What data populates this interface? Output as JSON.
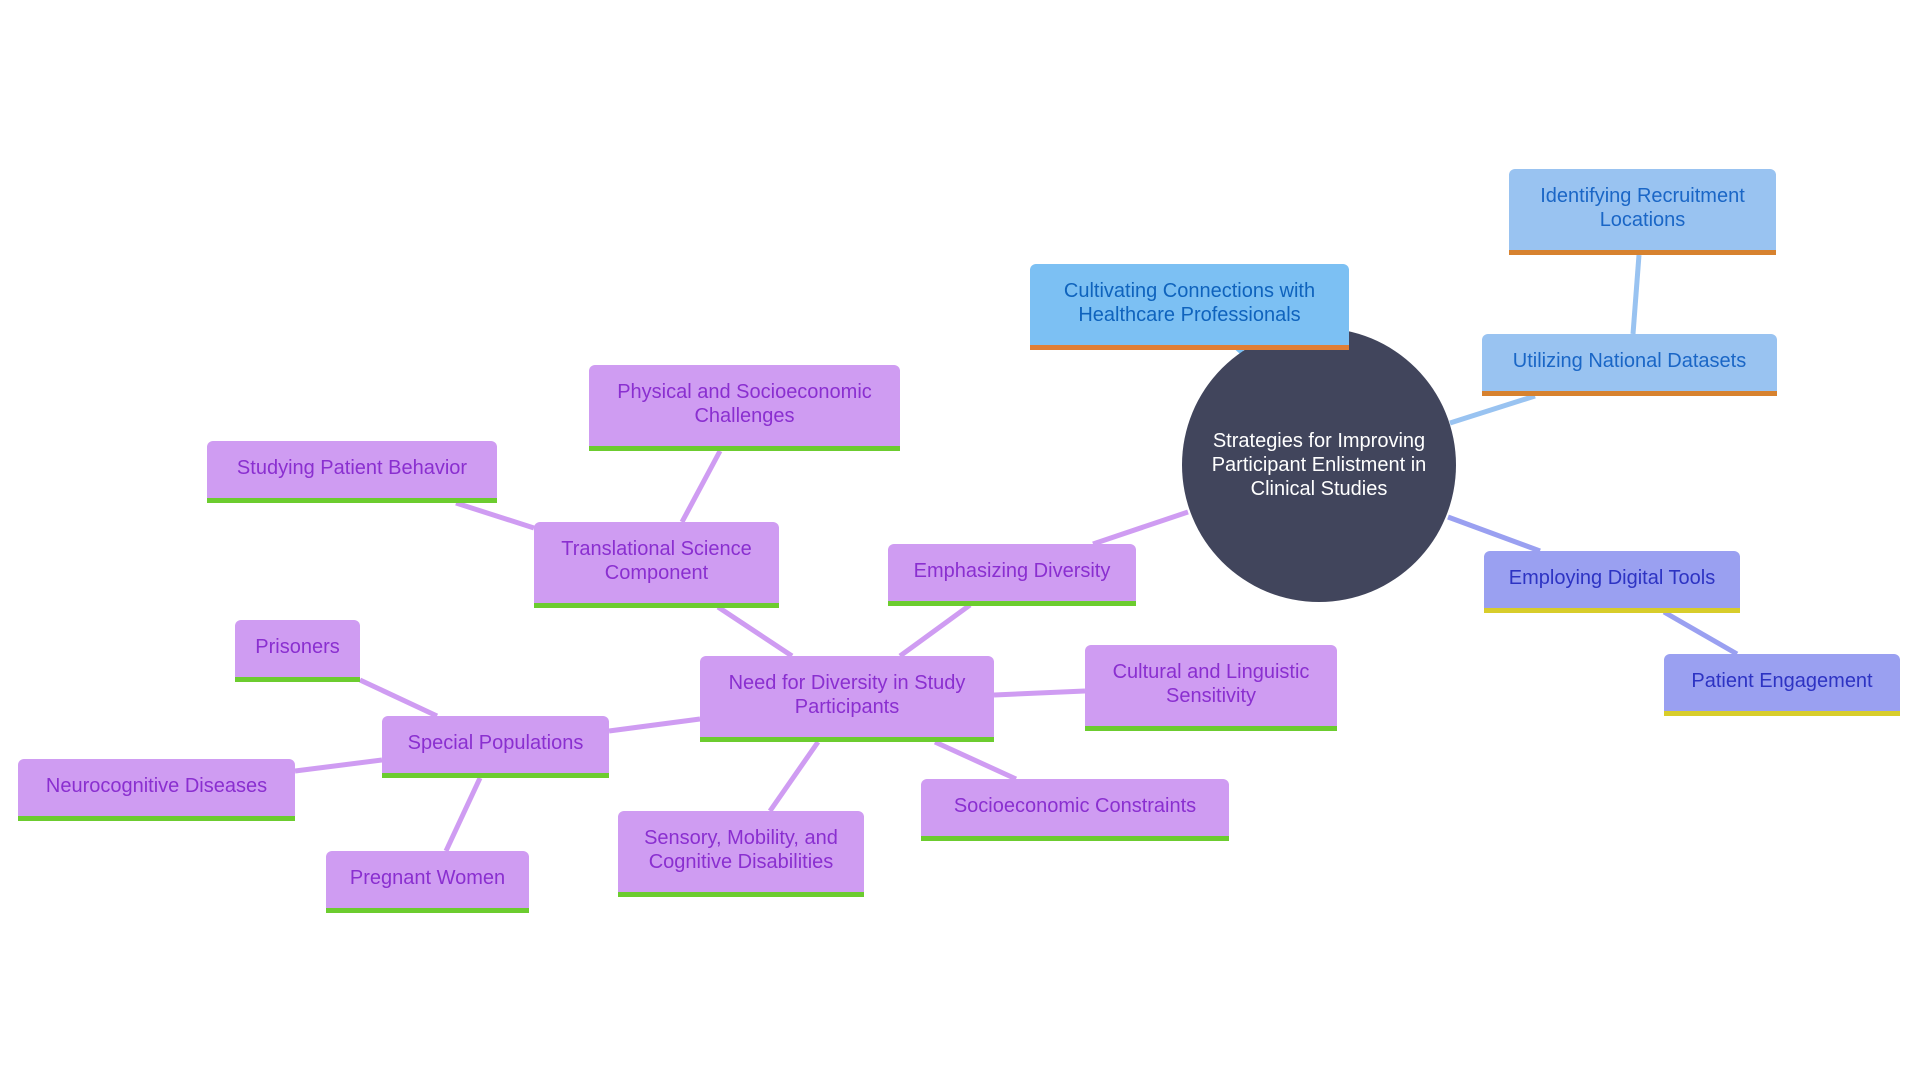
{
  "root": {
    "id": "root",
    "label": "Strategies for Improving Participant Enlistment in Clinical Studies",
    "color": "#41455c"
  },
  "colors": {
    "purple_fill": "#cf9cf2",
    "purple_text": "#8a2fd0",
    "purple_edge": "#cf9cf2",
    "green_accent": "#6ccc2f",
    "skyblue_fill": "#7cc0f3",
    "lightblue_fill": "#99c3f1",
    "blue_edge": "#99c3f1",
    "orange_accent": "#e07e35",
    "periwinkle_fill": "#9aa0f1",
    "periwinkle_edge": "#9aa0f1",
    "yellow_accent": "#d8cd2b"
  },
  "nodes": [
    {
      "id": "cultivating",
      "label": "Cultivating Connections with Healthcare Professionals",
      "parent": "root",
      "style": "skyblue"
    },
    {
      "id": "utilizing",
      "label": "Utilizing National Datasets",
      "parent": "root",
      "style": "lightblue"
    },
    {
      "id": "identifying",
      "label": "Identifying Recruitment Locations",
      "parent": "utilizing",
      "style": "lightblue"
    },
    {
      "id": "employing",
      "label": "Employing Digital Tools",
      "parent": "root",
      "style": "periwinkle"
    },
    {
      "id": "engagement",
      "label": "Patient Engagement",
      "parent": "employing",
      "style": "periwinkle"
    },
    {
      "id": "emphasizing",
      "label": "Emphasizing Diversity",
      "parent": "root",
      "style": "purple"
    },
    {
      "id": "need",
      "label": "Need for Diversity in Study Participants",
      "parent": "emphasizing",
      "style": "purple"
    },
    {
      "id": "cultural",
      "label": "Cultural and Linguistic Sensitivity",
      "parent": "need",
      "style": "purple"
    },
    {
      "id": "socioeconomic",
      "label": "Socioeconomic Constraints",
      "parent": "need",
      "style": "purple"
    },
    {
      "id": "sensory",
      "label": "Sensory, Mobility, and Cognitive Disabilities",
      "parent": "need",
      "style": "purple"
    },
    {
      "id": "special",
      "label": "Special Populations",
      "parent": "need",
      "style": "purple"
    },
    {
      "id": "prisoners",
      "label": "Prisoners",
      "parent": "special",
      "style": "purple"
    },
    {
      "id": "neuro",
      "label": "Neurocognitive Diseases",
      "parent": "special",
      "style": "purple"
    },
    {
      "id": "pregnant",
      "label": "Pregnant Women",
      "parent": "special",
      "style": "purple"
    },
    {
      "id": "translational",
      "label": "Translational Science Component",
      "parent": "need",
      "style": "purple"
    },
    {
      "id": "studying",
      "label": "Studying Patient Behavior",
      "parent": "translational",
      "style": "purple"
    },
    {
      "id": "physical",
      "label": "Physical and Socioeconomic Challenges",
      "parent": "translational",
      "style": "purple"
    }
  ]
}
